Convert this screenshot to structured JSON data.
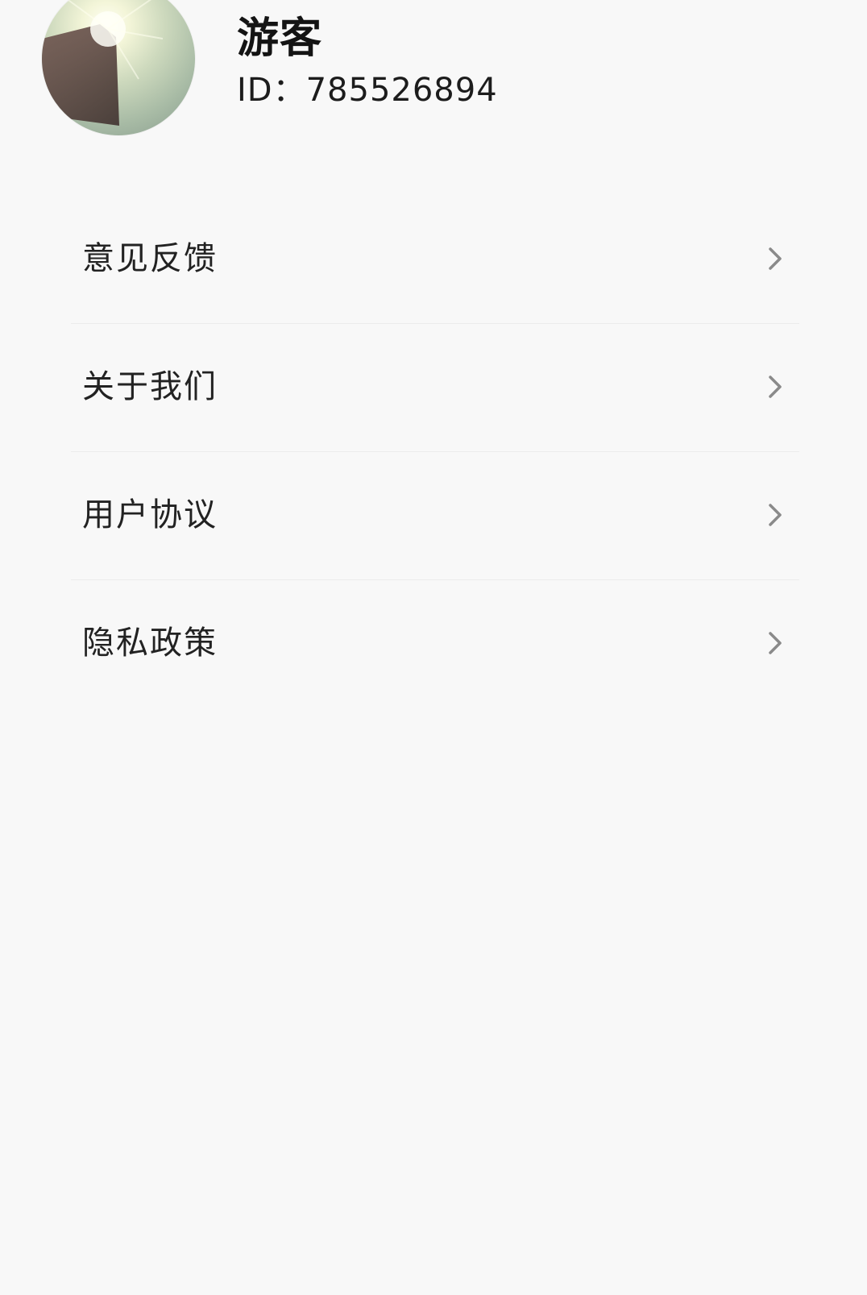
{
  "profile": {
    "name": "游客",
    "id_text": "ID：785526894",
    "avatar_icon": "profile-photo"
  },
  "menu": {
    "items": [
      {
        "label": "意见反馈",
        "icon": "chevron-right-icon"
      },
      {
        "label": "关于我们",
        "icon": "chevron-right-icon"
      },
      {
        "label": "用户协议",
        "icon": "chevron-right-icon"
      },
      {
        "label": "隐私政策",
        "icon": "chevron-right-icon"
      }
    ]
  },
  "colors": {
    "background": "#f8f8f8",
    "text_primary": "#141414",
    "text_menu": "#222222",
    "divider": "#ececec",
    "chevron": "#8a8a8a"
  }
}
